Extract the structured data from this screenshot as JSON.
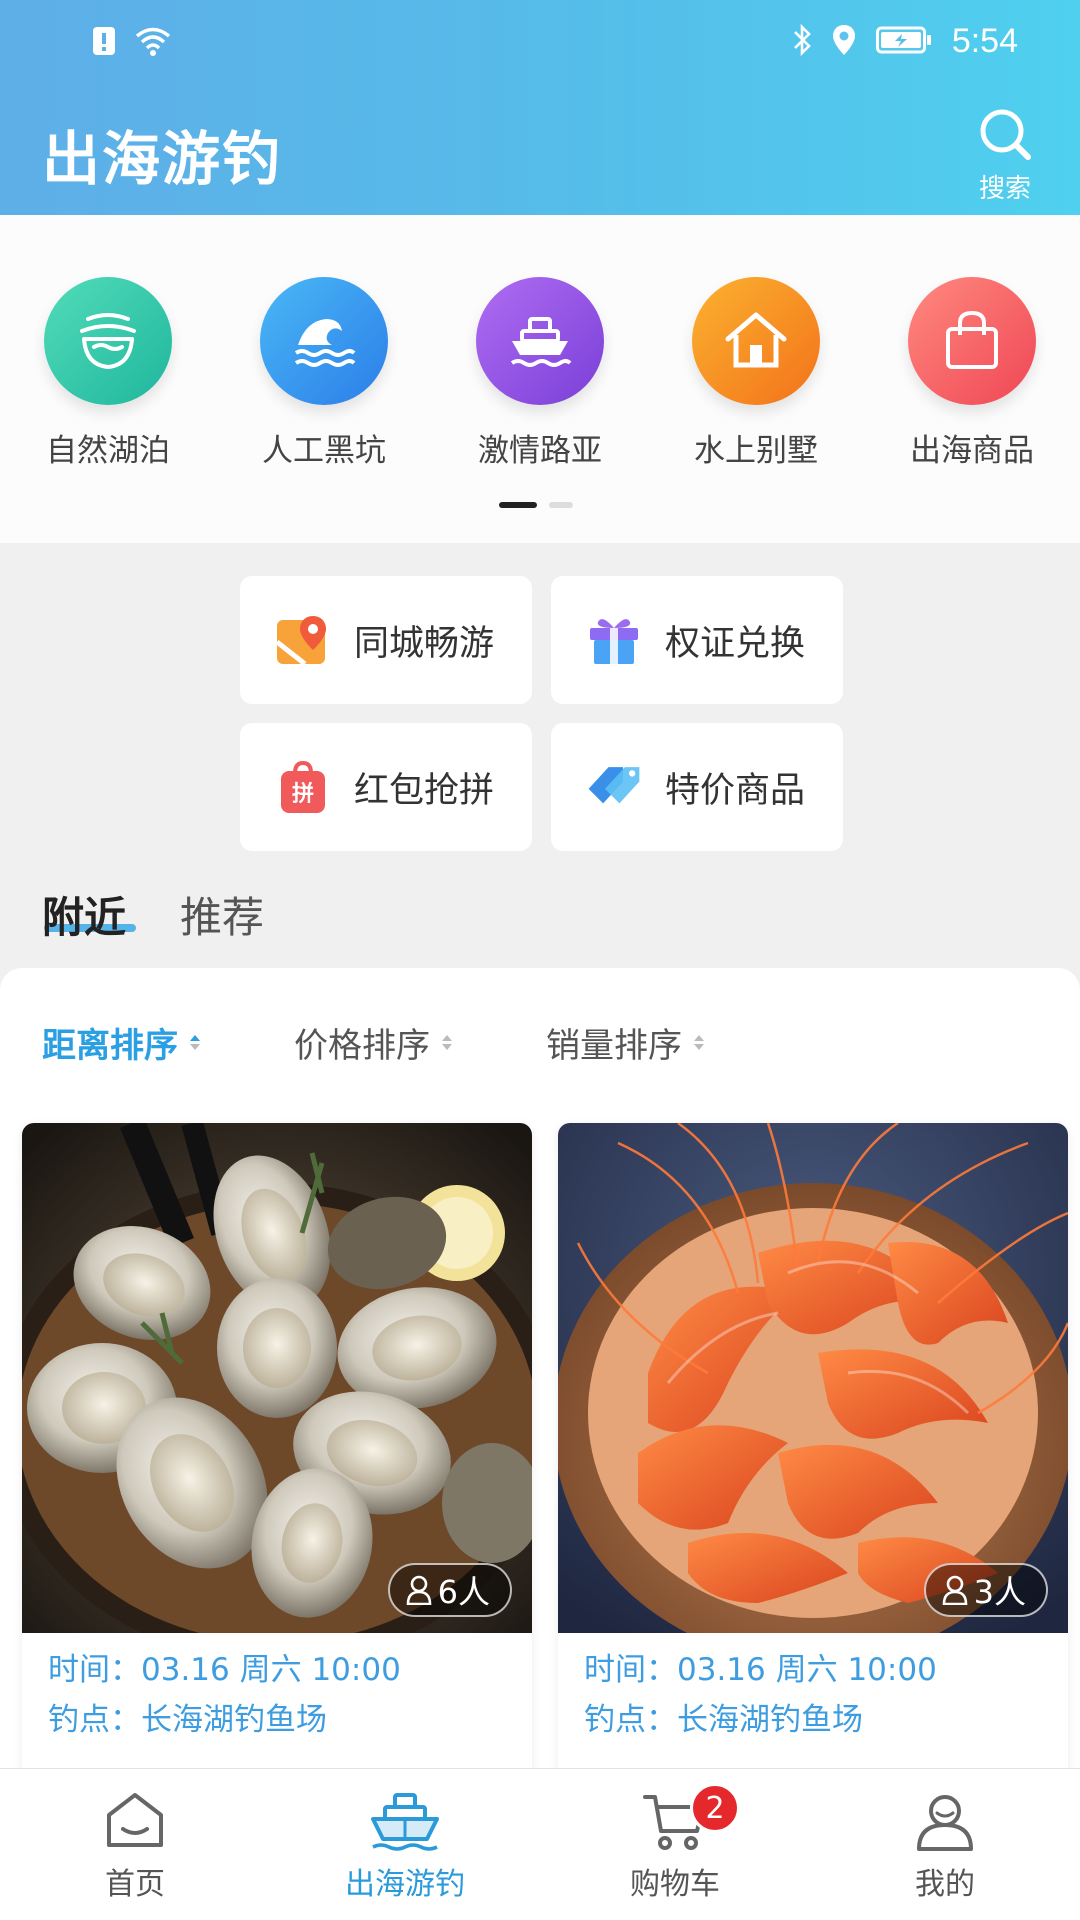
{
  "status_bar": {
    "time": "5:54"
  },
  "header": {
    "title": "出海游钓",
    "search_label": "搜索"
  },
  "categories": [
    {
      "label": "自然湖泊",
      "icon": "lake-icon",
      "color": "#2fc3a8"
    },
    {
      "label": "人工黑坑",
      "icon": "wave-icon",
      "color": "#3a9cf0"
    },
    {
      "label": "激情路亚",
      "icon": "ship-icon",
      "color": "#9a54e6"
    },
    {
      "label": "水上别墅",
      "icon": "house-icon",
      "color": "#f7921e"
    },
    {
      "label": "出海商品",
      "icon": "bag-icon",
      "color": "#f5605f"
    }
  ],
  "quick_actions": [
    {
      "label": "同城畅游",
      "icon": "map-pin-icon"
    },
    {
      "label": "权证兑换",
      "icon": "gift-icon"
    },
    {
      "label": "红包抢拼",
      "icon": "red-packet-icon",
      "icon_text": "拼"
    },
    {
      "label": "特价商品",
      "icon": "price-tag-icon"
    }
  ],
  "tabs": [
    {
      "label": "附近",
      "active": true
    },
    {
      "label": "推荐",
      "active": false
    }
  ],
  "sort_options": [
    {
      "label": "距离排序",
      "active": true
    },
    {
      "label": "价格排序",
      "active": false
    },
    {
      "label": "销量排序",
      "active": false
    }
  ],
  "cards": [
    {
      "image": "oysters",
      "people": "6人",
      "time": "时间：03.16 周六 10:00",
      "spot": "钓点：长海湖钓鱼场"
    },
    {
      "image": "shrimp",
      "people": "3人",
      "time": "时间：03.16 周六 10:00",
      "spot": "钓点：长海湖钓鱼场"
    }
  ],
  "bottom_nav": [
    {
      "label": "首页",
      "icon": "home-icon",
      "active": false
    },
    {
      "label": "出海游钓",
      "icon": "boat-icon",
      "active": true
    },
    {
      "label": "购物车",
      "icon": "cart-icon",
      "active": false,
      "badge": "2"
    },
    {
      "label": "我的",
      "icon": "user-icon",
      "active": false
    }
  ]
}
